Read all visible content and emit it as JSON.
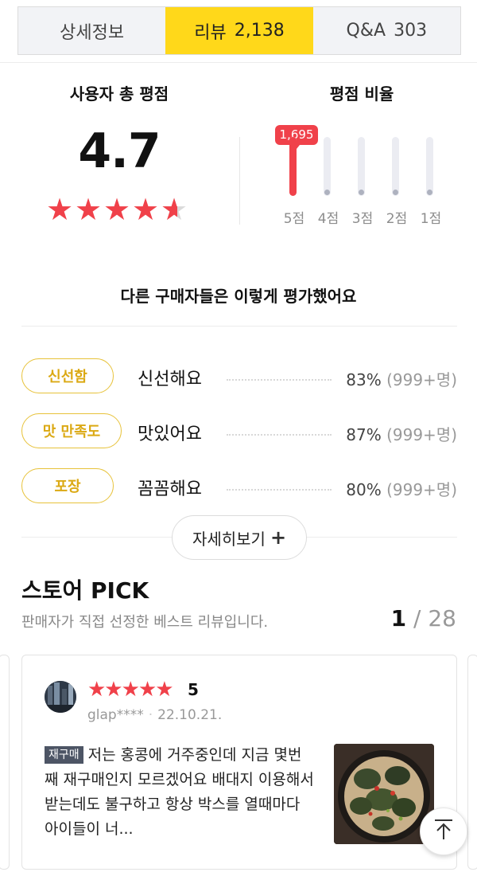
{
  "tabs": [
    {
      "label": "상세정보",
      "count": ""
    },
    {
      "label": "리뷰",
      "count": "2,138"
    },
    {
      "label": "Q&A",
      "count": "303"
    }
  ],
  "summary": {
    "total_title": "사용자 총 평점",
    "score": "4.7",
    "score_value": 4.7,
    "ratio_title": "평점 비율"
  },
  "distribution": [
    {
      "label": "5점",
      "value": 1695,
      "display": "1,695",
      "highlight": true
    },
    {
      "label": "4점",
      "value": 0,
      "display": "",
      "highlight": false
    },
    {
      "label": "3점",
      "value": 0,
      "display": "",
      "highlight": false
    },
    {
      "label": "2점",
      "value": 0,
      "display": "",
      "highlight": false
    },
    {
      "label": "1점",
      "value": 0,
      "display": "",
      "highlight": false
    }
  ],
  "others": {
    "title": "다른 구매자들은 이렇게 평가했어요",
    "items": [
      {
        "tag": "신선함",
        "text": "신선해요",
        "pct": "83%",
        "count": "(999+명)"
      },
      {
        "tag": "맛 만족도",
        "text": "맛있어요",
        "pct": "87%",
        "count": "(999+명)"
      },
      {
        "tag": "포장",
        "text": "꼼꼼해요",
        "pct": "80%",
        "count": "(999+명)"
      }
    ],
    "more_label": "자세히보기",
    "more_plus": "+"
  },
  "store_pick": {
    "title": "스토어 PICK",
    "subtitle": "판매자가 직접 선정한 베스트 리뷰입니다.",
    "page_current": "1",
    "page_sep": "/",
    "page_total": "28"
  },
  "review": {
    "stars": "★★★★★",
    "score": "5",
    "user": "glap****",
    "date": "22.10.21.",
    "badge": "재구매",
    "text": "저는 홍콩에 거주중인데 지금 몇번째 재구매인지 모르겠어요 배대지 이용해서 받는데도 불구하고 항상 박스를 열때마다 아이들이 너..."
  },
  "colors": {
    "accent_yellow": "#ffd81a",
    "star_red": "#f0414a",
    "tag_gold": "#dba914"
  },
  "icons": {
    "scroll_top": "arrow-up-to-line-icon"
  }
}
